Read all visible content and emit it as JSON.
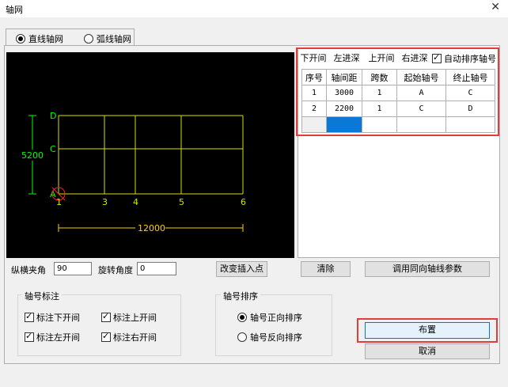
{
  "window": {
    "title": "轴网",
    "close_glyph": "✕"
  },
  "modes": [
    {
      "label": "直线轴网",
      "selected": true
    },
    {
      "label": "弧线轴网",
      "selected": false
    }
  ],
  "canvas": {
    "row_labels": [
      "D",
      "C",
      "A"
    ],
    "col_labels": [
      "1",
      "3",
      "4",
      "5",
      "6"
    ],
    "vertical_dim": "5200",
    "horizontal_dim": "12000"
  },
  "tabs": [
    "下开间",
    "左进深",
    "上开间",
    "右进深"
  ],
  "active_tab": "左进深",
  "auto_sort_label": "自动排序轴号",
  "table": {
    "headers": [
      "序号",
      "轴间距",
      "跨数",
      "起始轴号",
      "终止轴号"
    ],
    "rows": [
      [
        "1",
        "3000",
        "1",
        "A",
        "C"
      ],
      [
        "2",
        "2200",
        "1",
        "C",
        "D"
      ]
    ]
  },
  "controls": {
    "angle_label": "纵横夹角",
    "angle_value": "90",
    "rotate_label": "旋转角度",
    "rotate_value": "0",
    "change_insert_btn": "改变插入点",
    "clear_btn": "清除",
    "load_params_btn": "调用同向轴线参数"
  },
  "axis_label_group": {
    "title": "轴号标注",
    "items": [
      {
        "label": "标注下开间",
        "checked": true
      },
      {
        "label": "标注上开间",
        "checked": true
      },
      {
        "label": "标注左开间",
        "checked": true
      },
      {
        "label": "标注右开间",
        "checked": true
      }
    ]
  },
  "axis_sort_group": {
    "title": "轴号排序",
    "items": [
      {
        "label": "轴号正向排序",
        "selected": true
      },
      {
        "label": "轴号反向排序",
        "selected": false
      }
    ]
  },
  "actions": {
    "place_btn": "布置",
    "cancel_btn": "取消"
  },
  "colors": {
    "grid": "#d6e000",
    "axis_label": "#00ff00",
    "dim": "#ffd000",
    "highlight": "#e23c3c",
    "selection": "#0a78d7"
  }
}
